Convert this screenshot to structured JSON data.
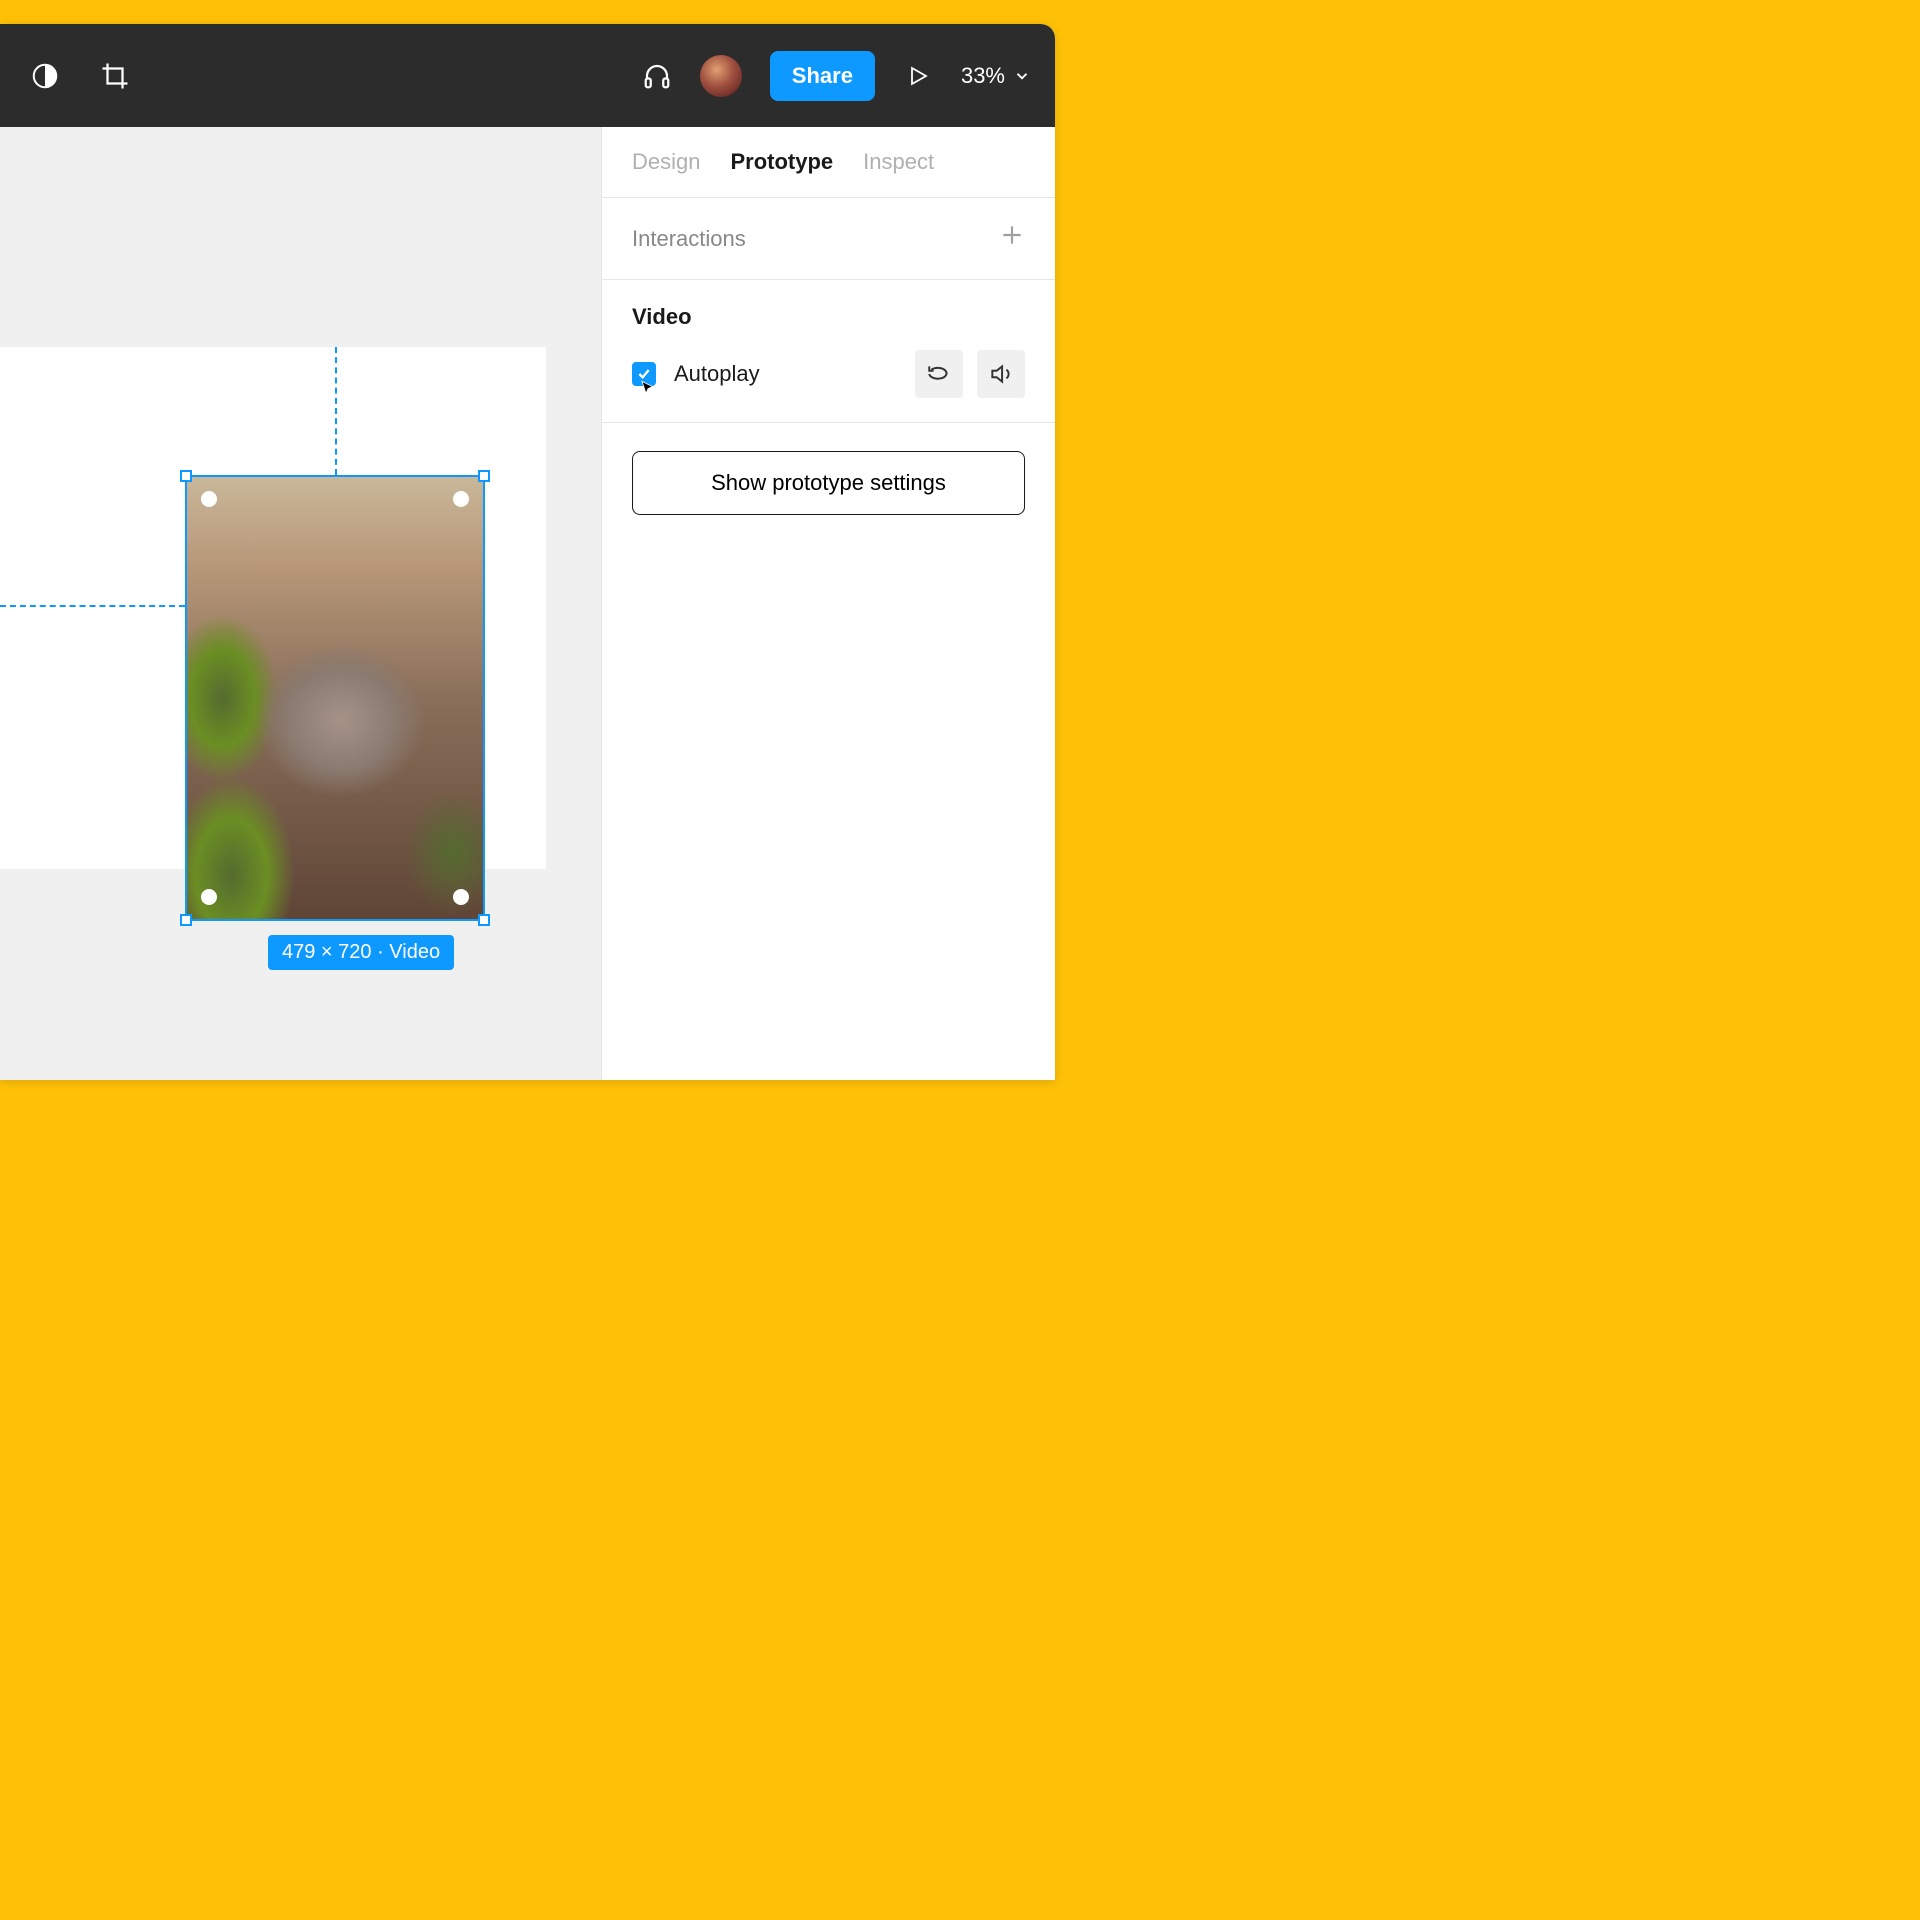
{
  "toolbar": {
    "share_label": "Share",
    "zoom": "33%"
  },
  "canvas": {
    "selection_label": "479 × 720 · Video"
  },
  "panel": {
    "tabs": {
      "design": "Design",
      "prototype": "Prototype",
      "inspect": "Inspect"
    },
    "interactions": {
      "title": "Interactions"
    },
    "video": {
      "title": "Video",
      "autoplay_label": "Autoplay",
      "autoplay_checked": true
    },
    "prototype_settings_button": "Show prototype settings"
  }
}
